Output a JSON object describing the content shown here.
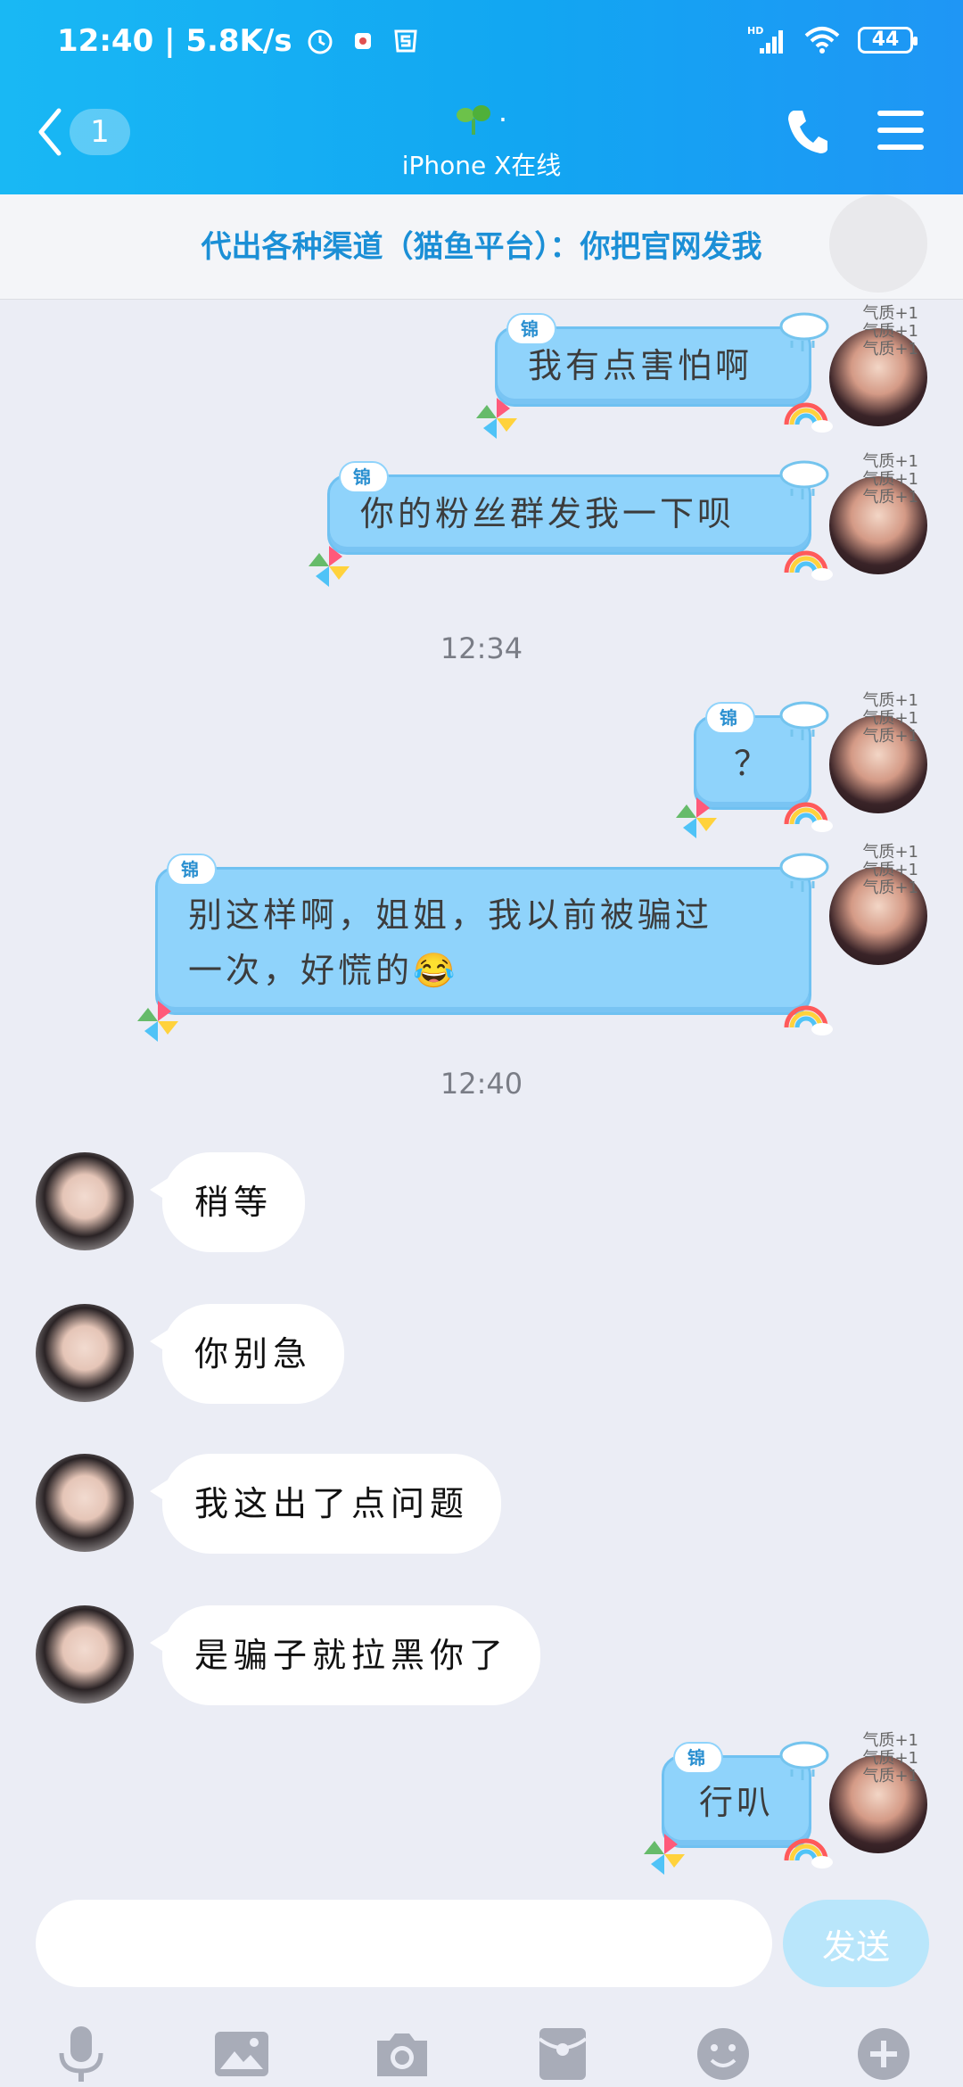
{
  "status_bar": {
    "time_speed": "12:40 | 5.8K/s",
    "network_label": "HD",
    "battery": "44"
  },
  "nav": {
    "unread_count": "1",
    "contact_name": "·",
    "contact_status": "iPhone X在线"
  },
  "pinned": {
    "text": "代出各种渠道（猫鱼平台）：你把官网发我"
  },
  "messages": {
    "out_1": "我有点害怕啊",
    "out_2": "你的粉丝群发我一下呗",
    "time_1": "12:34",
    "out_3": "？",
    "out_4_line1": "别这样啊，姐姐，我以前被骗过",
    "out_4_line2": "一次，好慌的😂",
    "time_2": "12:40",
    "in_1": "稍等",
    "in_2": "你别急",
    "in_3": "我这出了点问题",
    "in_4": "是骗子就拉黑你了",
    "out_5": "行叭"
  },
  "labels": {
    "tag": "锦",
    "badge_line": "气质+1"
  },
  "input": {
    "placeholder": "",
    "send_label": "发送"
  },
  "toolbar": {
    "icons": [
      "microphone-icon",
      "image-icon",
      "camera-icon",
      "red-packet-icon",
      "emoji-icon",
      "plus-icon"
    ]
  },
  "colors": {
    "header_start": "#19b8f4",
    "header_end": "#1f96f5",
    "bubble_out": "#8fd3fb",
    "pinned_text": "#1b8fd6",
    "send_button": "#b9e6fb"
  }
}
